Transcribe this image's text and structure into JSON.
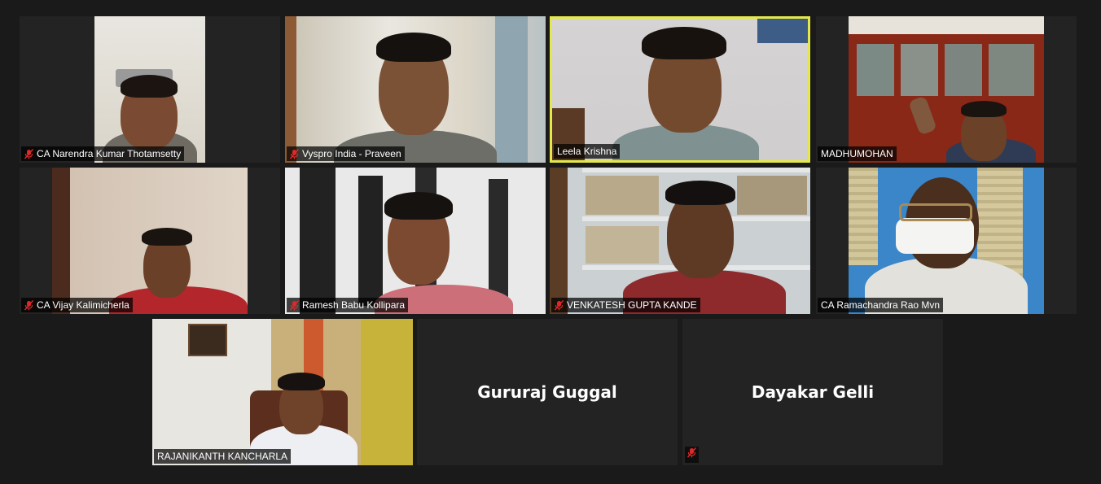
{
  "participants": [
    {
      "name": "CA Narendra Kumar Thotamsetty",
      "muted": true
    },
    {
      "name": "Vyspro India - Praveen",
      "muted": true
    },
    {
      "name": "Leela Krishna",
      "muted": false,
      "active_speaker": true
    },
    {
      "name": "MADHUMOHAN",
      "muted": false
    },
    {
      "name": "CA Vijay Kalimicherla",
      "muted": true
    },
    {
      "name": "Ramesh Babu Kollipara",
      "muted": true
    },
    {
      "name": "VENKATESH GUPTA KANDE",
      "muted": true
    },
    {
      "name": "CA Ramachandra Rao Mvn",
      "muted": false
    },
    {
      "name": "RAJANIKANTH KANCHARLA",
      "muted": false
    },
    {
      "name": "Gururaj Guggal",
      "muted": false,
      "video_off": true
    },
    {
      "name": "Dayakar Gelli",
      "muted": true,
      "video_off": true
    }
  ],
  "colors": {
    "background": "#1a1a1a",
    "tile": "#232323",
    "active_border": "#e6e84a",
    "muted_icon": "#e02828"
  },
  "icons": {
    "muted": "mic-off-icon"
  }
}
